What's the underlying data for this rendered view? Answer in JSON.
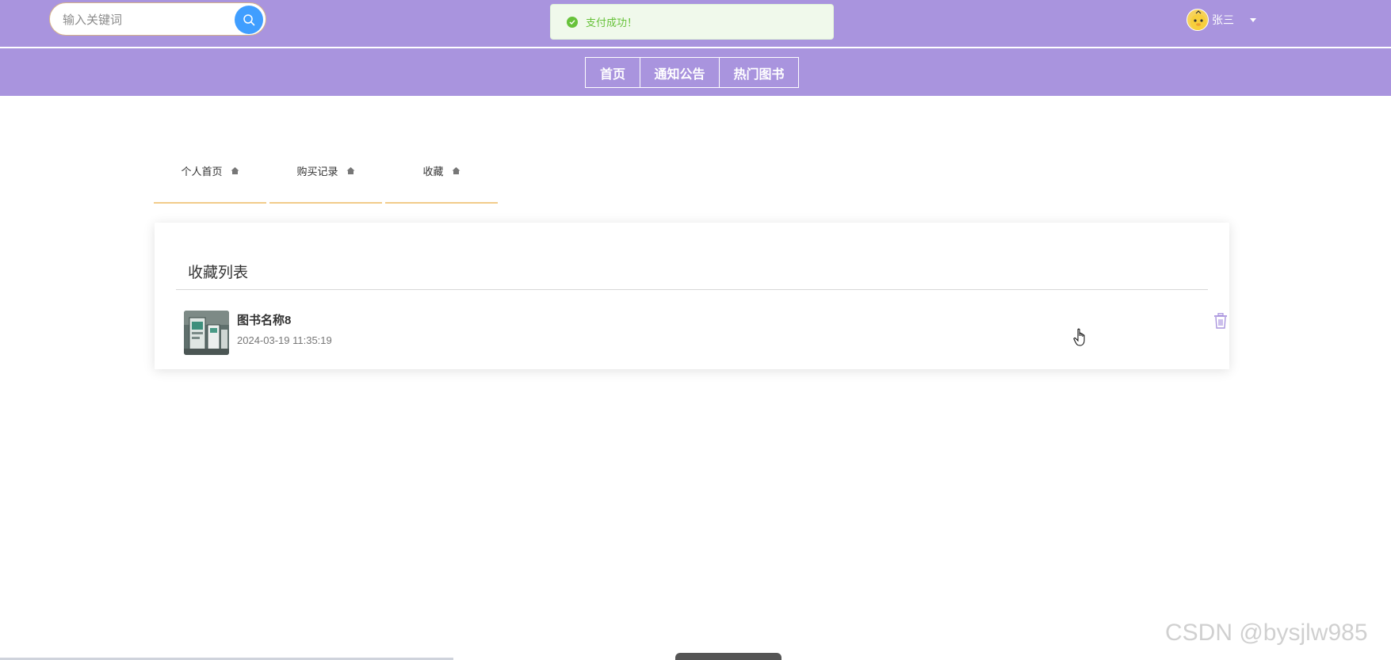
{
  "search": {
    "placeholder": "输入关键词",
    "icon": "search-icon"
  },
  "toast": {
    "message": "支付成功！",
    "icon": "check-circle-icon",
    "color": "#67c23a"
  },
  "user": {
    "name": "张三",
    "avatar_icon": "avatar-icon"
  },
  "nav": {
    "items": [
      {
        "label": "首页"
      },
      {
        "label": "通知公告"
      },
      {
        "label": "热门图书"
      }
    ]
  },
  "tabs": [
    {
      "label": "个人首页",
      "icon": "house-icon"
    },
    {
      "label": "购买记录",
      "icon": "house-icon"
    },
    {
      "label": "收藏",
      "icon": "house-icon"
    }
  ],
  "favorites": {
    "title": "收藏列表",
    "items": [
      {
        "name": "图书名称8",
        "time": "2024-03-19 11:35:19",
        "delete_icon": "trash-icon"
      }
    ]
  },
  "watermark": "CSDN @bysjlw985",
  "colors": {
    "header_bg": "#a994de",
    "accent": "#409eff",
    "tab_underline": "#f2cb8a",
    "success": "#67c23a"
  }
}
